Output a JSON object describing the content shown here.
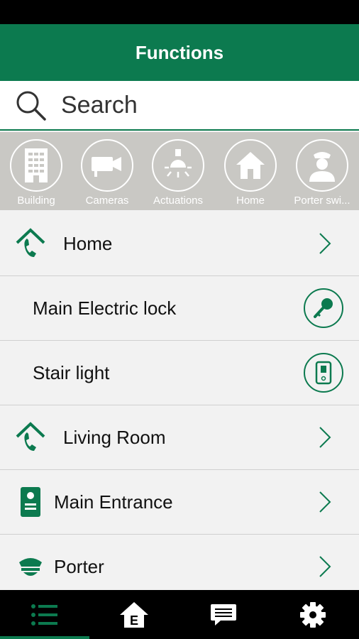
{
  "header": {
    "title": "Functions"
  },
  "search": {
    "placeholder": "Search"
  },
  "categories": [
    {
      "label": "Building",
      "icon": "building-icon"
    },
    {
      "label": "Cameras",
      "icon": "camera-icon"
    },
    {
      "label": "Actuations",
      "icon": "light-bulb-icon"
    },
    {
      "label": "Home",
      "icon": "home-icon"
    },
    {
      "label": "Porter swi...",
      "icon": "porter-icon"
    }
  ],
  "list": [
    {
      "label": "Home",
      "icon": "home-phone-icon",
      "trailing": "chevron"
    },
    {
      "label": "Main Electric lock",
      "trailing": "key-button"
    },
    {
      "label": "Stair light",
      "trailing": "switch-button"
    },
    {
      "label": "Living Room",
      "icon": "home-phone-icon",
      "trailing": "chevron"
    },
    {
      "label": "Main Entrance",
      "icon": "intercom-panel-icon",
      "trailing": "chevron"
    },
    {
      "label": "Porter",
      "icon": "porter-cap-icon",
      "trailing": "chevron"
    }
  ],
  "tabs": [
    {
      "icon": "list-icon",
      "active": true
    },
    {
      "icon": "home-e-icon",
      "active": false
    },
    {
      "icon": "chat-icon",
      "active": false
    },
    {
      "icon": "gear-icon",
      "active": false
    }
  ],
  "colors": {
    "primary": "#0c7a4f",
    "category_bar": "#c9c8c4",
    "list_bg": "#f2f2f2",
    "bottom_bar": "#000000"
  }
}
